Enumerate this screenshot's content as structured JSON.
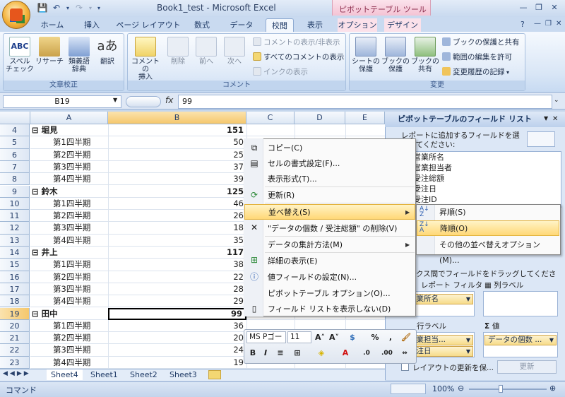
{
  "window": {
    "title": "Book1_test - Microsoft Excel",
    "context_tab_group": "ピボットテーブル ツール"
  },
  "tabs": [
    "ホーム",
    "挿入",
    "ページ レイアウト",
    "数式",
    "データ",
    "校閲",
    "表示",
    "オプション",
    "デザイン"
  ],
  "ribbon": {
    "groups": {
      "proofing": "文章校正",
      "comments": "コメント",
      "changes": "変更"
    },
    "buttons": {
      "spell": "スペル\nチェック",
      "research": "リサーチ",
      "thesaurus": "類義語\n辞典",
      "translate": "翻訳",
      "new_comment": "コメントの\n挿入",
      "delete": "削除",
      "prev": "前へ",
      "next": "次へ",
      "show_hide_comment": "コメントの表示/非表示",
      "show_all_comments": "すべてのコメントの表示",
      "show_ink": "インクの表示",
      "protect_sheet": "シートの\n保護",
      "protect_workbook": "ブックの\n保護",
      "share_workbook": "ブックの\n共有",
      "protect_share": "ブックの保護と共有",
      "allow_edit_ranges": "範囲の編集を許可",
      "track_changes": "変更履歴の記録"
    }
  },
  "formula_bar": {
    "name_box": "B19",
    "fx": "fx",
    "content": "99"
  },
  "grid": {
    "columns": [
      "A",
      "B",
      "C",
      "D",
      "E"
    ],
    "rows": [
      {
        "n": "4",
        "a": "⊟ 堀見",
        "b": "151",
        "group": true
      },
      {
        "n": "5",
        "a": "第1四半期",
        "b": "50"
      },
      {
        "n": "6",
        "a": "第2四半期",
        "b": "25"
      },
      {
        "n": "7",
        "a": "第3四半期",
        "b": "37"
      },
      {
        "n": "8",
        "a": "第4四半期",
        "b": "39"
      },
      {
        "n": "9",
        "a": "⊟ 鈴木",
        "b": "125",
        "group": true
      },
      {
        "n": "10",
        "a": "第1四半期",
        "b": "46"
      },
      {
        "n": "11",
        "a": "第2四半期",
        "b": "26"
      },
      {
        "n": "12",
        "a": "第3四半期",
        "b": "18"
      },
      {
        "n": "13",
        "a": "第4四半期",
        "b": "35"
      },
      {
        "n": "14",
        "a": "⊟ 井上",
        "b": "117",
        "group": true
      },
      {
        "n": "15",
        "a": "第1四半期",
        "b": "38"
      },
      {
        "n": "16",
        "a": "第2四半期",
        "b": "22"
      },
      {
        "n": "17",
        "a": "第3四半期",
        "b": "28"
      },
      {
        "n": "18",
        "a": "第4四半期",
        "b": "29"
      },
      {
        "n": "19",
        "a": "⊟ 田中",
        "b": "99",
        "group": true,
        "selected": true
      },
      {
        "n": "20",
        "a": "第1四半期",
        "b": "36"
      },
      {
        "n": "21",
        "a": "第2四半期",
        "b": "20"
      },
      {
        "n": "22",
        "a": "第3四半期",
        "b": "24"
      },
      {
        "n": "23",
        "a": "第4四半期",
        "b": "19"
      }
    ]
  },
  "sheets": [
    "Sheet4",
    "Sheet1",
    "Sheet2",
    "Sheet3"
  ],
  "status": {
    "mode": "コマンド",
    "zoom": "100%"
  },
  "pane": {
    "title": "ピボットテーブルのフィールド リスト",
    "instruction": "レポートに追加するフィールドを選択してください:",
    "fields": [
      "営業所名",
      "営業担当者",
      "受注総額",
      "受注日",
      "受注ID"
    ],
    "drag_instruction": "ボックス間でフィールドをドラッグしてください:",
    "report_filter": "レポート フィルタ",
    "column_label": "列ラベル",
    "row_label": "行ラベル",
    "values": "値",
    "filter_chip": "営業所名",
    "row_chips": [
      "営業担当...",
      "受注日"
    ],
    "value_chip": "データの個数 ...",
    "defer_update": "レイアウトの更新を保...",
    "update_button": "更新"
  },
  "context_menu": {
    "items": [
      "コピー(C)",
      "セルの書式設定(F)...",
      "表示形式(T)...",
      "更新(R)",
      "並べ替え(S)",
      "\"データの個数 / 受注総額\" の削除(V)",
      "データの集計方法(M)",
      "詳細の表示(E)",
      "値フィールドの設定(N)...",
      "ピボットテーブル オプション(O)...",
      "フィールド リストを表示しない(D)"
    ]
  },
  "submenu": {
    "items": [
      "昇順(S)",
      "降順(O)",
      "その他の並べ替えオプション(M)..."
    ]
  },
  "mini_toolbar": {
    "font": "MS Pゴー",
    "size": "11"
  }
}
